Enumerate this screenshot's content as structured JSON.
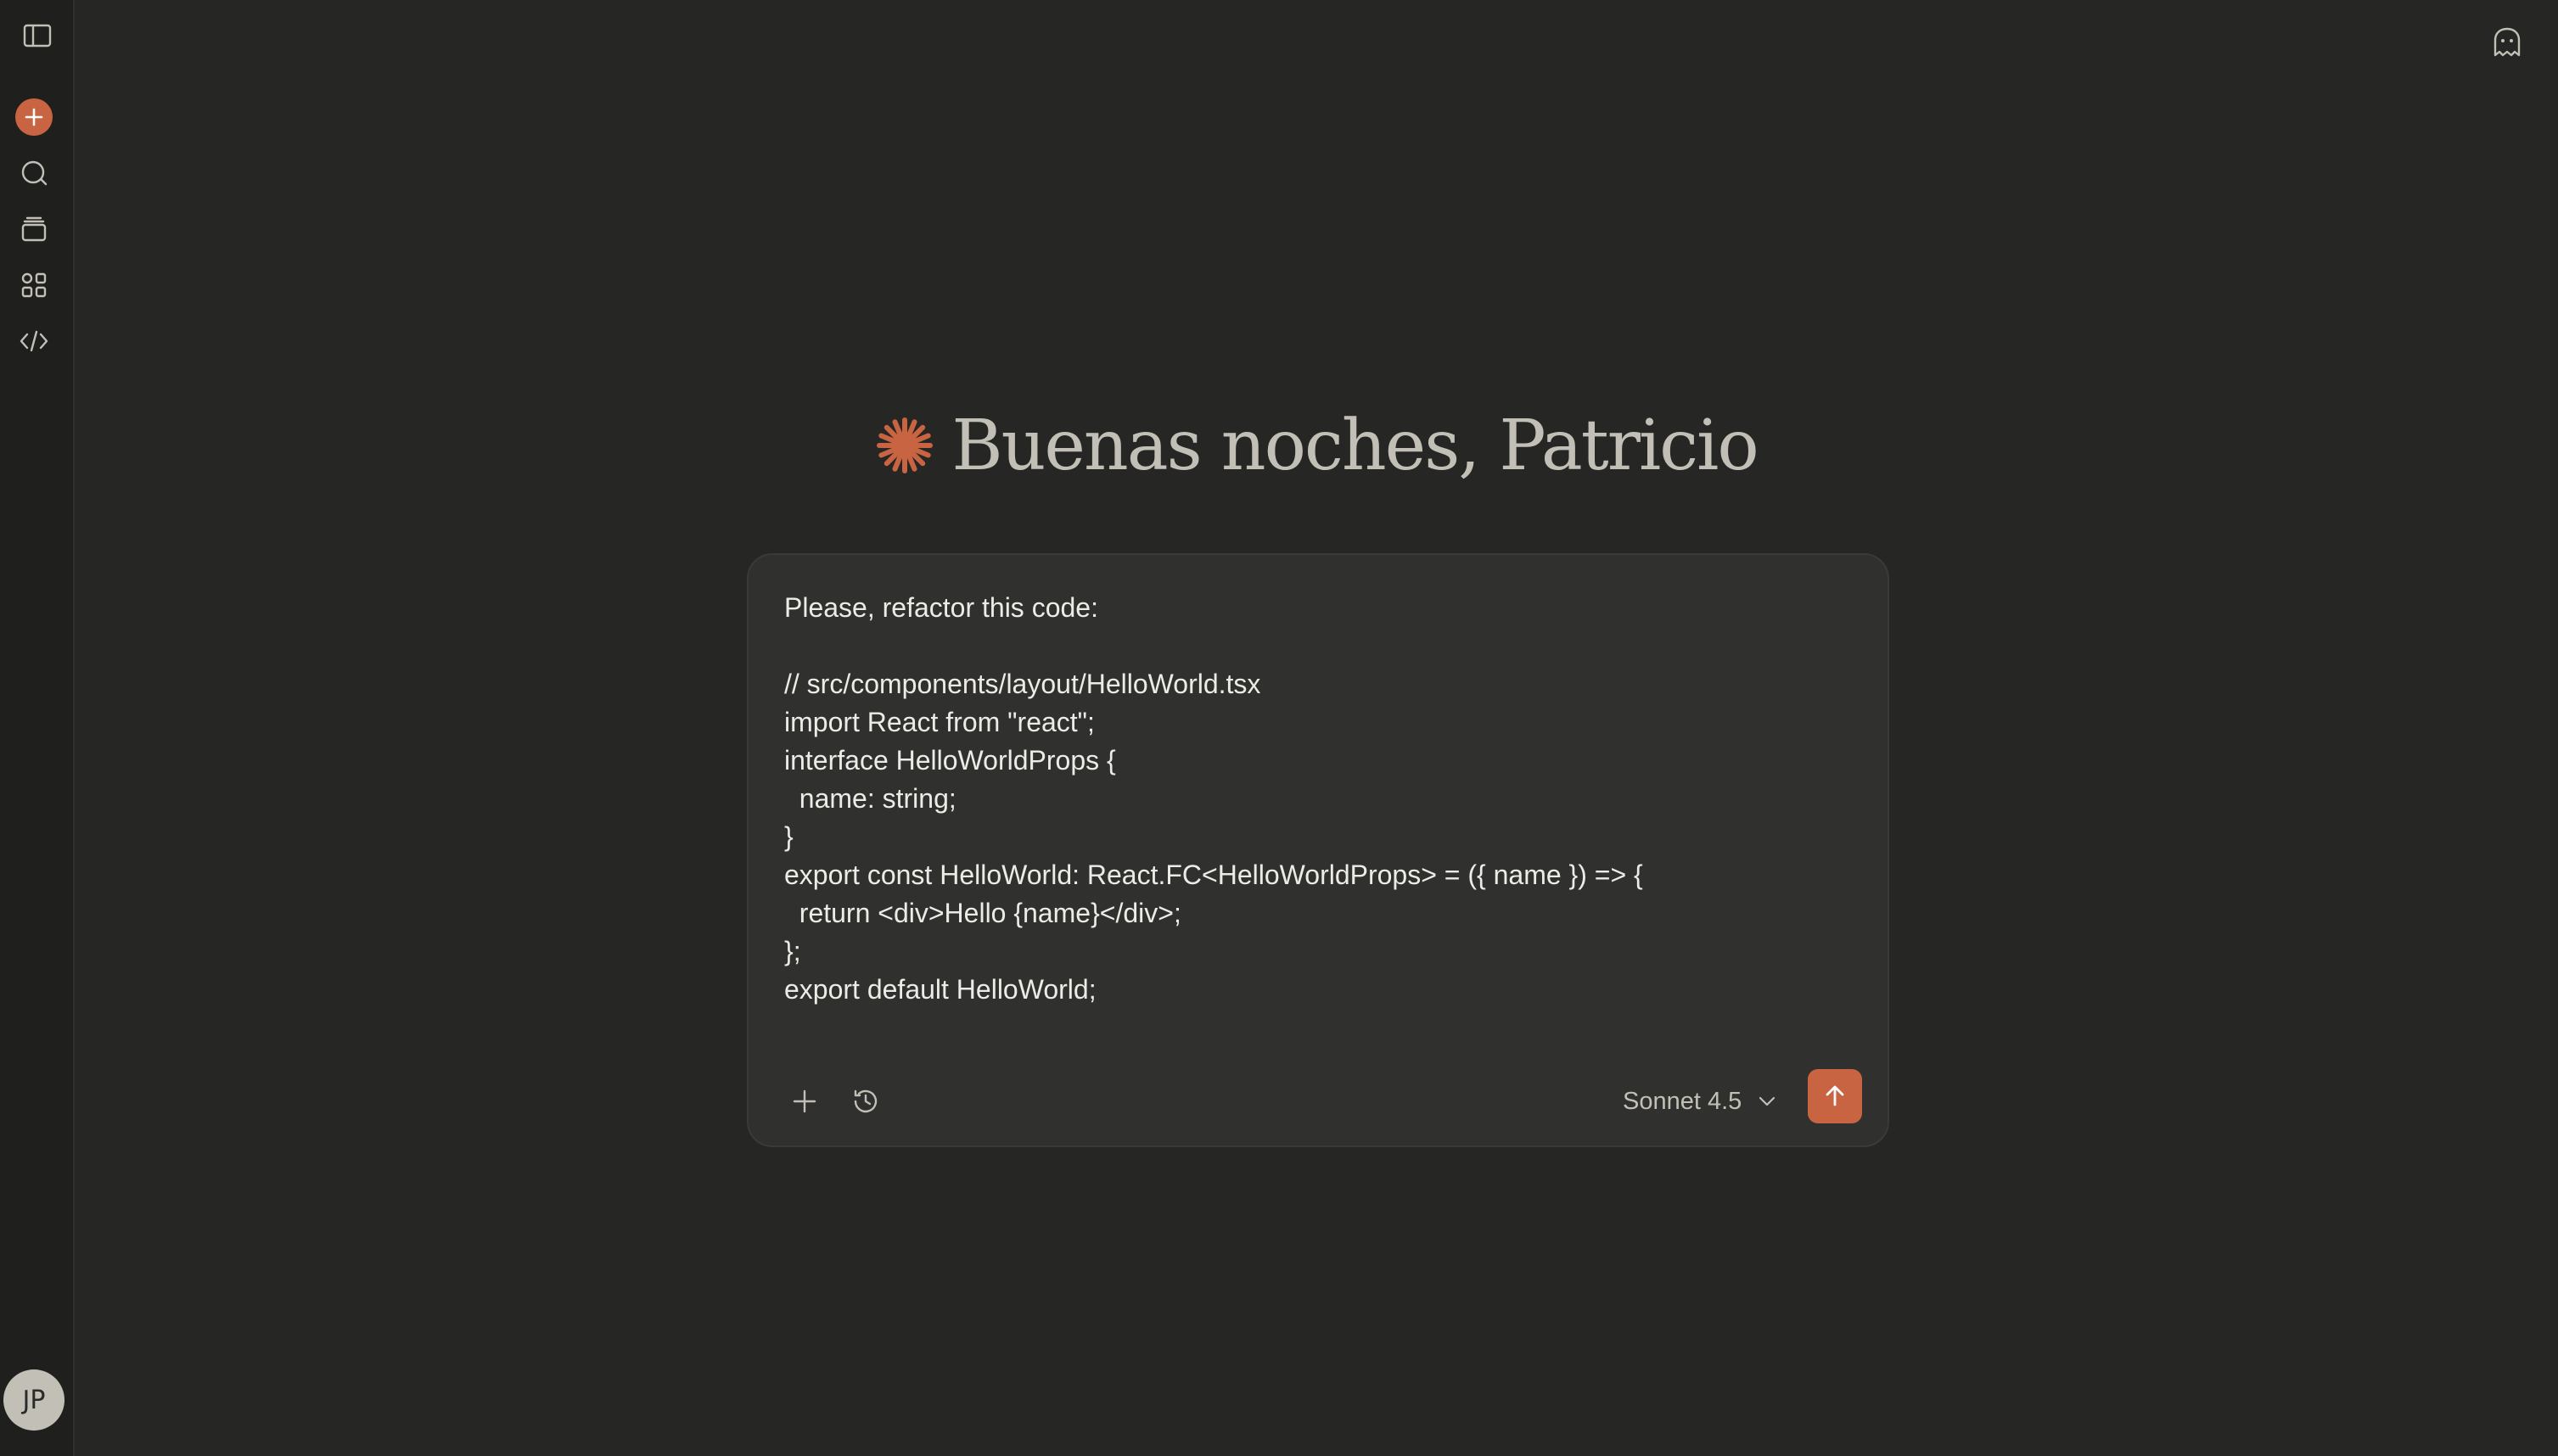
{
  "sidebar": {
    "toggle_icon": "sidebar-toggle-icon",
    "new_chat_icon": "plus-icon",
    "items": [
      {
        "name": "chats",
        "icon": "chat-bubble-icon"
      },
      {
        "name": "projects",
        "icon": "projects-icon"
      },
      {
        "name": "artifacts",
        "icon": "artifacts-icon"
      },
      {
        "name": "code",
        "icon": "code-icon"
      }
    ],
    "avatar_initials": "JP"
  },
  "header": {
    "incognito_icon": "ghost-icon"
  },
  "greeting": {
    "text": "Buenas noches, Patricio",
    "logo_icon": "starburst-icon",
    "accent_color": "#c96442"
  },
  "composer": {
    "prompt": "Please, refactor this code:\n\n// src/components/layout/HelloWorld.tsx\nimport React from \"react\";\ninterface HelloWorldProps {\n  name: string;\n}\nexport const HelloWorld: React.FC<HelloWorldProps> = ({ name }) => {\n  return <div>Hello {name}</div>;\n};\nexport default HelloWorld;",
    "add_icon": "plus-icon",
    "history_icon": "clock-icon",
    "model": "Sonnet 4.5",
    "send_icon": "arrow-up-icon"
  }
}
